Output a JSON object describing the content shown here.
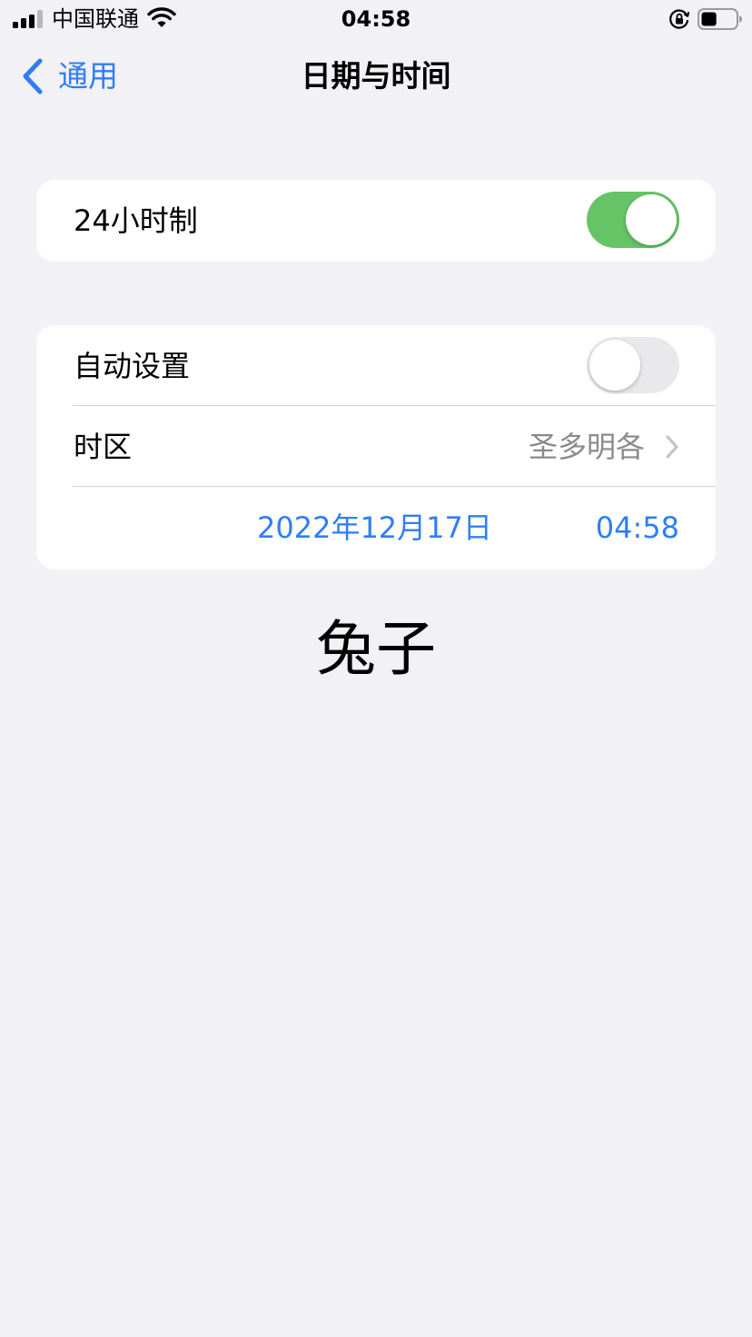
{
  "status_bar": {
    "carrier": "中国联通",
    "time": "04:58",
    "signal_icon": "cellular-signal-icon",
    "wifi_icon": "wifi-icon",
    "orientation_lock_icon": "orientation-lock-icon",
    "battery_icon": "battery-icon",
    "battery_level": 0.45
  },
  "nav": {
    "back_label": "通用",
    "title": "日期与时间"
  },
  "settings": {
    "twenty_four_hour": {
      "label": "24小时制",
      "enabled": true
    },
    "auto_set": {
      "label": "自动设置",
      "enabled": false
    },
    "time_zone": {
      "label": "时区",
      "value": "圣多明各"
    },
    "date_time": {
      "date": "2022年12月17日",
      "time": "04:58"
    }
  },
  "overlay_text": "兔子",
  "colors": {
    "accent": "#2f7ef5",
    "toggle_on": "#65c466",
    "toggle_off": "#e9e9eb",
    "background": "#f2f1f6",
    "secondary_text": "#8a8a8e"
  }
}
